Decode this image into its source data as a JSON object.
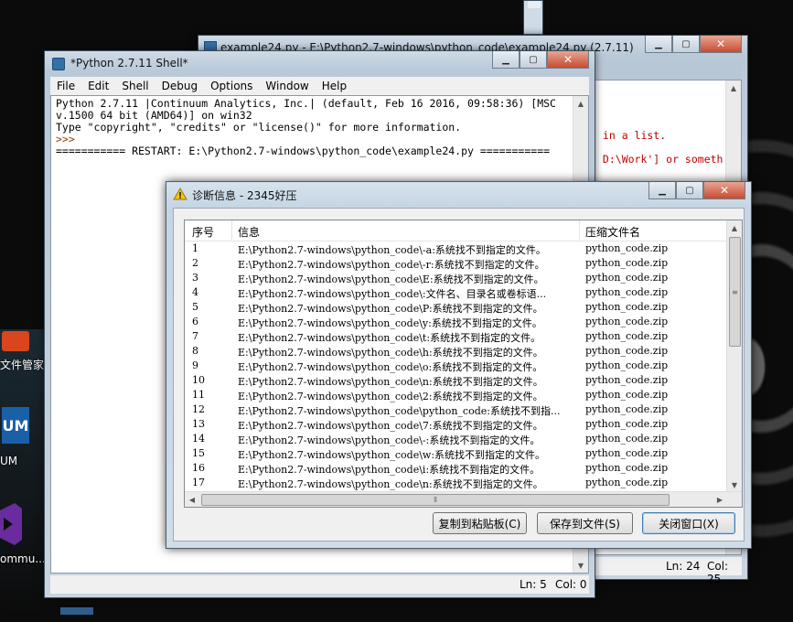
{
  "desktop": {
    "icons": [
      {
        "label": "文件管家",
        "color": "#d9461e"
      },
      {
        "label": "UM",
        "text": "UM",
        "color": "#1b5fa8"
      },
      {
        "label": "ommu...",
        "color": "#6a2b9e"
      }
    ]
  },
  "editor_window": {
    "title": "example24.py - E:\\Python2.7-windows\\python_code\\example24.py (2.7.11)",
    "lines": [
      " in a list.",
      " D:\\Work'] or someth"
    ],
    "status": {
      "ln": "Ln: 24",
      "col": "Col: 25"
    }
  },
  "shell_window": {
    "title": "*Python 2.7.11 Shell*",
    "menu": [
      "File",
      "Edit",
      "Shell",
      "Debug",
      "Options",
      "Window",
      "Help"
    ],
    "lines": [
      "Python 2.7.11 |Continuum Analytics, Inc.| (default, Feb 16 2016, 09:58:36) [MSC",
      "v.1500 64 bit (AMD64)] on win32",
      "Type \"copyright\", \"credits\" or \"license()\" for more information.",
      ">>> ",
      "=========== RESTART: E:\\Python2.7-windows\\python_code\\example24.py ==========="
    ],
    "status": {
      "ln": "Ln: 5",
      "col": "Col: 0"
    }
  },
  "dialog": {
    "title": "诊断信息 - 2345好压",
    "columns": [
      "序号",
      "信息",
      "压缩文件名"
    ],
    "rows": [
      {
        "n": "1",
        "info": "E:\\Python2.7-windows\\python_code\\-a:系统找不到指定的文件。",
        "file": "python_code.zip"
      },
      {
        "n": "2",
        "info": "E:\\Python2.7-windows\\python_code\\-r:系统找不到指定的文件。",
        "file": "python_code.zip"
      },
      {
        "n": "3",
        "info": "E:\\Python2.7-windows\\python_code\\E:系统找不到指定的文件。",
        "file": "python_code.zip"
      },
      {
        "n": "4",
        "info": "E:\\Python2.7-windows\\python_code\\:文件名、目录名或卷标语...",
        "file": "python_code.zip"
      },
      {
        "n": "5",
        "info": "E:\\Python2.7-windows\\python_code\\P:系统找不到指定的文件。",
        "file": "python_code.zip"
      },
      {
        "n": "6",
        "info": "E:\\Python2.7-windows\\python_code\\y:系统找不到指定的文件。",
        "file": "python_code.zip"
      },
      {
        "n": "7",
        "info": "E:\\Python2.7-windows\\python_code\\t:系统找不到指定的文件。",
        "file": "python_code.zip"
      },
      {
        "n": "8",
        "info": "E:\\Python2.7-windows\\python_code\\h:系统找不到指定的文件。",
        "file": "python_code.zip"
      },
      {
        "n": "9",
        "info": "E:\\Python2.7-windows\\python_code\\o:系统找不到指定的文件。",
        "file": "python_code.zip"
      },
      {
        "n": "10",
        "info": "E:\\Python2.7-windows\\python_code\\n:系统找不到指定的文件。",
        "file": "python_code.zip"
      },
      {
        "n": "11",
        "info": "E:\\Python2.7-windows\\python_code\\2:系统找不到指定的文件。",
        "file": "python_code.zip"
      },
      {
        "n": "12",
        "info": "E:\\Python2.7-windows\\python_code\\python_code:系统找不到指...",
        "file": "python_code.zip"
      },
      {
        "n": "13",
        "info": "E:\\Python2.7-windows\\python_code\\7:系统找不到指定的文件。",
        "file": "python_code.zip"
      },
      {
        "n": "14",
        "info": "E:\\Python2.7-windows\\python_code\\-:系统找不到指定的文件。",
        "file": "python_code.zip"
      },
      {
        "n": "15",
        "info": "E:\\Python2.7-windows\\python_code\\w:系统找不到指定的文件。",
        "file": "python_code.zip"
      },
      {
        "n": "16",
        "info": "E:\\Python2.7-windows\\python_code\\i:系统找不到指定的文件。",
        "file": "python_code.zip"
      },
      {
        "n": "17",
        "info": "E:\\Python2.7-windows\\python_code\\n:系统找不到指定的文件。",
        "file": "python_code.zip"
      }
    ],
    "buttons": {
      "copy": "复制到粘贴板(C)",
      "save": "保存到文件(S)",
      "close": "关闭窗口(X)"
    }
  },
  "colors": {
    "idle_keyword": "#c00000",
    "warning": "#f4c21d"
  },
  "window_buttons": {
    "min": "▁",
    "max": "▢",
    "close": "✕"
  }
}
